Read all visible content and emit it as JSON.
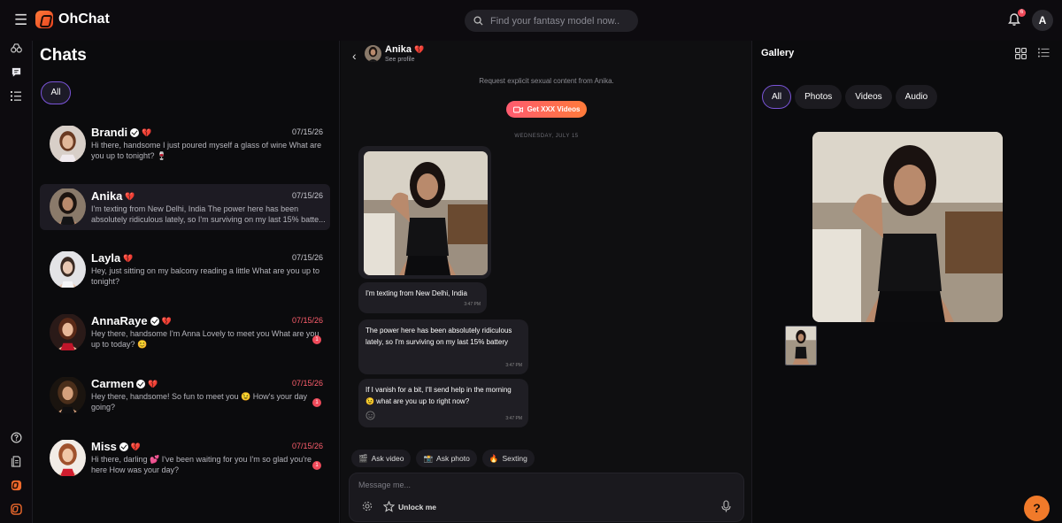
{
  "app": {
    "name": "OhChat"
  },
  "search": {
    "placeholder": "Find your fantasy model now.."
  },
  "notifications": {
    "count": "6"
  },
  "user": {
    "initial": "A"
  },
  "chats": {
    "title": "Chats",
    "filter": "All",
    "items": [
      {
        "name": "Brandi",
        "date": "07/15/26",
        "preview": "Hi there, handsome I just poured myself a glass of wine What are you up to tonight? 🍷",
        "verified": true,
        "heart": "💔",
        "unread": ""
      },
      {
        "name": "Anika",
        "date": "07/15/26",
        "preview": "I'm texting from New Delhi, India The power here has been absolutely ridiculous lately, so I'm surviving on my last 15% batte...",
        "verified": false,
        "heart": "💔",
        "unread": ""
      },
      {
        "name": "Layla",
        "date": "07/15/26",
        "preview": "Hey, just sitting on my balcony reading a little What are you up to tonight?",
        "verified": false,
        "heart": "💔",
        "unread": ""
      },
      {
        "name": "AnnaRaye",
        "date": "07/15/26",
        "preview": "Hey there, handsome I'm Anna Lovely to meet you What are you up to today? 😊",
        "verified": true,
        "heart": "💔",
        "unread": "1"
      },
      {
        "name": "Carmen",
        "date": "07/15/26",
        "preview": "Hey there, handsome! So fun to meet you 😉 How's your day going?",
        "verified": true,
        "heart": "💔",
        "unread": "1"
      },
      {
        "name": "Miss",
        "date": "07/15/26",
        "preview": "Hi there, darling 💕 I've been waiting for you I'm so glad you're here How was your day?",
        "verified": true,
        "heart": "💔",
        "unread": "1"
      }
    ]
  },
  "conversation": {
    "name": "Anika",
    "heart": "💔",
    "see_profile": "See profile",
    "request_text": "Request explicit sexual content from Anika.",
    "xxx_button": "Get XXX Videos",
    "date_divider": "WEDNESDAY, JULY 15",
    "messages": [
      {
        "text": "I'm texting from New Delhi, India",
        "time": "3:47 PM"
      },
      {
        "text": "The power here has been absolutely ridiculous lately, so I'm surviving on my last 15% battery",
        "time": "3:47 PM"
      },
      {
        "text": "If I vanish for a bit, I'll send help in the morning 😉 what are you up to right now?",
        "time": "3:47 PM"
      }
    ],
    "chips": [
      {
        "icon": "🎬",
        "label": "Ask video"
      },
      {
        "icon": "📸",
        "label": "Ask photo"
      },
      {
        "icon": "🔥",
        "label": "Sexting"
      }
    ],
    "composer_placeholder": "Message me...",
    "unlock_label": "Unlock me"
  },
  "gallery": {
    "title": "Gallery",
    "tabs": [
      "All",
      "Photos",
      "Videos",
      "Audio"
    ],
    "selected_tab": "All"
  },
  "help": {
    "label": "?"
  }
}
